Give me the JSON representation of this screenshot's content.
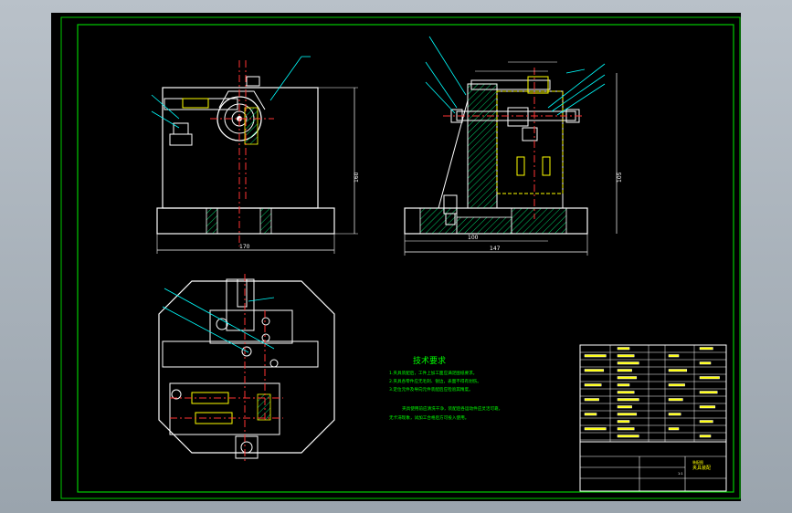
{
  "drawing": {
    "notes": {
      "title": "技术要求",
      "lines": [
        "1.夹具装配后，工件上加工面应满足图纸要求。",
        "2.夹具各零件应无毛刺、锐边，表面不得有划伤。",
        "3.定位元件及导向元件装配后应检验其精度。",
        "夹具使用前应清洗干净，装配后各运动件应灵活可靠，",
        "无卡滞现象，试加工合格后方可投入使用。"
      ]
    },
    "dimensions": {
      "front_height": "160",
      "front_width": "170",
      "side_width_top": "100",
      "side_width_bottom": "147",
      "side_height": "105"
    },
    "title_block": {
      "drawing_name": "夹具装配",
      "material": "装配图",
      "scale": "1:1"
    },
    "colors": {
      "background": "#000000",
      "outline": "#ffffff",
      "border": "#00cc00",
      "centerline": "#ff3333",
      "hatch": "#00ff00",
      "part_detail": "#ffff00",
      "leader": "#00ffff"
    }
  }
}
